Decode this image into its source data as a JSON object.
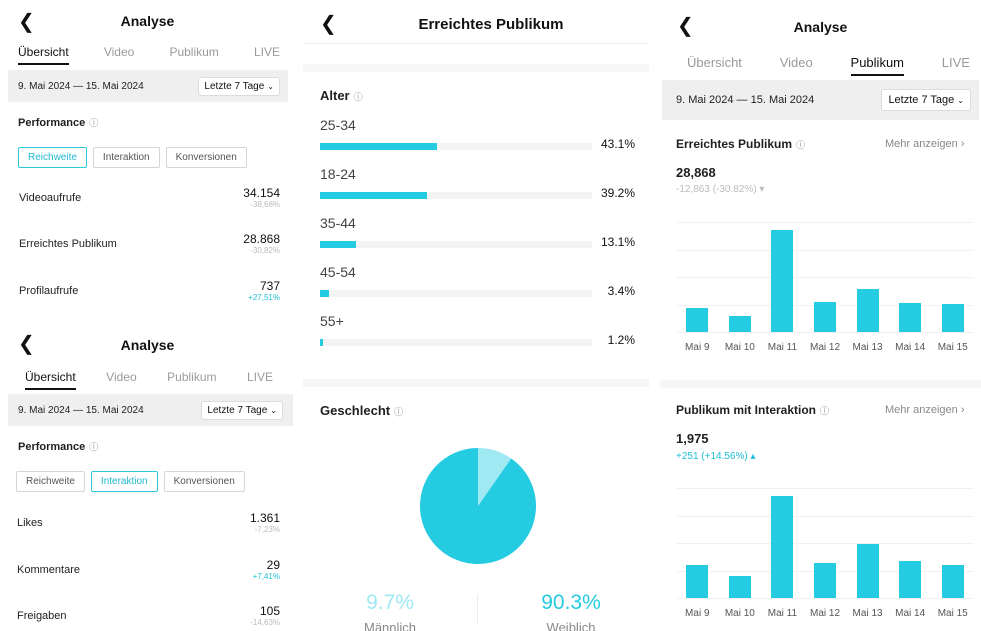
{
  "analyse_title": "Analyse",
  "tabs": [
    "Übersicht",
    "Video",
    "Publikum",
    "LIVE"
  ],
  "date_range": "9. Mai 2024 — 15. Mai 2024",
  "date_select": "Letzte 7 Tage",
  "performance_label": "Performance",
  "segments": [
    "Reichweite",
    "Interaktion",
    "Konversionen"
  ],
  "panel_top_left": {
    "active_segment": "Reichweite",
    "metrics": [
      {
        "label": "Videoaufrufe",
        "value": "34.154",
        "change": "-38,68%"
      },
      {
        "label": "Erreichtes Publikum",
        "value": "28.868",
        "change": "-30,82%"
      },
      {
        "label": "Profilaufrufe",
        "value": "737",
        "change": "+27,51%"
      }
    ]
  },
  "panel_bottom_left": {
    "active_segment": "Interaktion",
    "metrics": [
      {
        "label": "Likes",
        "value": "1.361",
        "change": "-7,23%"
      },
      {
        "label": "Kommentare",
        "value": "29",
        "change": "+7,41%"
      },
      {
        "label": "Freigaben",
        "value": "105",
        "change": "-14,63%"
      }
    ]
  },
  "panel_middle": {
    "title": "Erreichtes Publikum",
    "age_header": "Alter",
    "age_groups": [
      {
        "label": "25-34",
        "pct_text": "43.1%",
        "pct": 43.1
      },
      {
        "label": "18-24",
        "pct_text": "39.2%",
        "pct": 39.2
      },
      {
        "label": "35-44",
        "pct_text": "13.1%",
        "pct": 13.1
      },
      {
        "label": "45-54",
        "pct_text": "3.4%",
        "pct": 3.4
      },
      {
        "label": "55+",
        "pct_text": "1.2%",
        "pct": 1.2
      }
    ],
    "gender_header": "Geschlecht",
    "gender": [
      {
        "label": "Männlich",
        "pct_text": "9.7%",
        "pct": 9.7,
        "color": "#9fe9f3"
      },
      {
        "label": "Weiblich",
        "pct_text": "90.3%",
        "pct": 90.3,
        "color": "#25cbe0"
      }
    ]
  },
  "panel_right": {
    "date_range": "9. Mai 2024 — 15. Mai 2024",
    "active_tab": "Publikum",
    "more_label": "Mehr anzeigen",
    "reached": {
      "title": "Erreichtes Publikum",
      "value": "28,868",
      "change": "-12,863 (-30.82%)",
      "change_icon": "down-arrow-icon"
    },
    "engaged": {
      "title": "Publikum mit Interaktion",
      "value": "1,975",
      "change": "+251 (+14.56%)",
      "change_icon": "up-arrow-icon"
    }
  },
  "chart_data": [
    {
      "type": "bar",
      "categories": [
        "Mai 9",
        "Mai 10",
        "Mai 11",
        "Mai 12",
        "Mai 13",
        "Mai 14",
        "Mai 15"
      ],
      "values": [
        2300,
        1500,
        9800,
        2900,
        4100,
        2800,
        2700
      ],
      "title": "Erreichtes Publikum",
      "xlabel": "",
      "ylabel": "",
      "grid": true
    },
    {
      "type": "bar",
      "categories": [
        "Mai 9",
        "Mai 10",
        "Mai 11",
        "Mai 12",
        "Mai 13",
        "Mai 14",
        "Mai 15"
      ],
      "values": [
        180,
        120,
        550,
        190,
        290,
        200,
        180
      ],
      "title": "Publikum mit Interaktion",
      "xlabel": "",
      "ylabel": "",
      "grid": true
    }
  ],
  "colors": {
    "accent": "#25cbe0",
    "accent_light": "#9fe9f3",
    "text": "#111111",
    "muted": "#9a9a9a"
  }
}
